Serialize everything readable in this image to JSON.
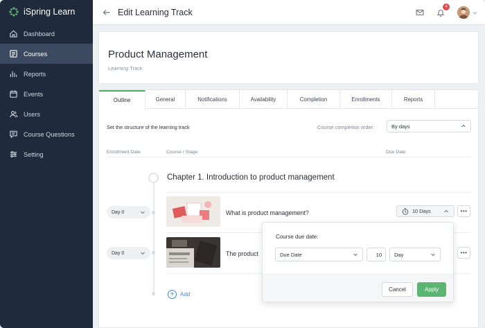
{
  "app": {
    "name": "iSpring Learn"
  },
  "sidebar": {
    "items": [
      {
        "label": "Dashboard",
        "icon": "home-icon"
      },
      {
        "label": "Courses",
        "icon": "courses-icon",
        "active": true
      },
      {
        "label": "Reports",
        "icon": "reports-icon"
      },
      {
        "label": "Events",
        "icon": "calendar-icon"
      },
      {
        "label": "Users",
        "icon": "users-icon"
      },
      {
        "label": "Course Questions",
        "icon": "chat-icon"
      },
      {
        "label": "Setting",
        "icon": "sliders-icon"
      }
    ]
  },
  "topbar": {
    "title": "Edit Learning Track",
    "notifications_count": "4"
  },
  "header": {
    "title": "Product Management",
    "subtitle": "Learning Track"
  },
  "tabs": [
    "Outline",
    "General",
    "Notifications",
    "Availability",
    "Completion",
    "Enrollments",
    "Reports"
  ],
  "outline": {
    "structure_label": "Set the structure of the learning track",
    "order_label": "Course completion order:",
    "order_value": "By days",
    "col_enrollment": "Enrollment Date",
    "col_course": "Course / Stage",
    "col_due": "Due Date",
    "chapter_title": "Chapter 1. Introduction to product management",
    "courses": [
      {
        "day": "Day 0",
        "name": "What is product management?",
        "due": "10 Days"
      },
      {
        "day": "Day 0",
        "name": "The product"
      }
    ],
    "add_label": "Add"
  },
  "popover": {
    "title": "Course due date:",
    "type_value": "Due Date",
    "number_value": "10",
    "unit_value": "Day",
    "cancel_label": "Cancel",
    "apply_label": "Apply"
  },
  "colors": {
    "sidebar_bg": "#1f2a3c",
    "sidebar_active": "#3b4a61",
    "accent_green": "#5cb573",
    "link_blue": "#4a86c5",
    "badge_red": "#e24b4b"
  }
}
